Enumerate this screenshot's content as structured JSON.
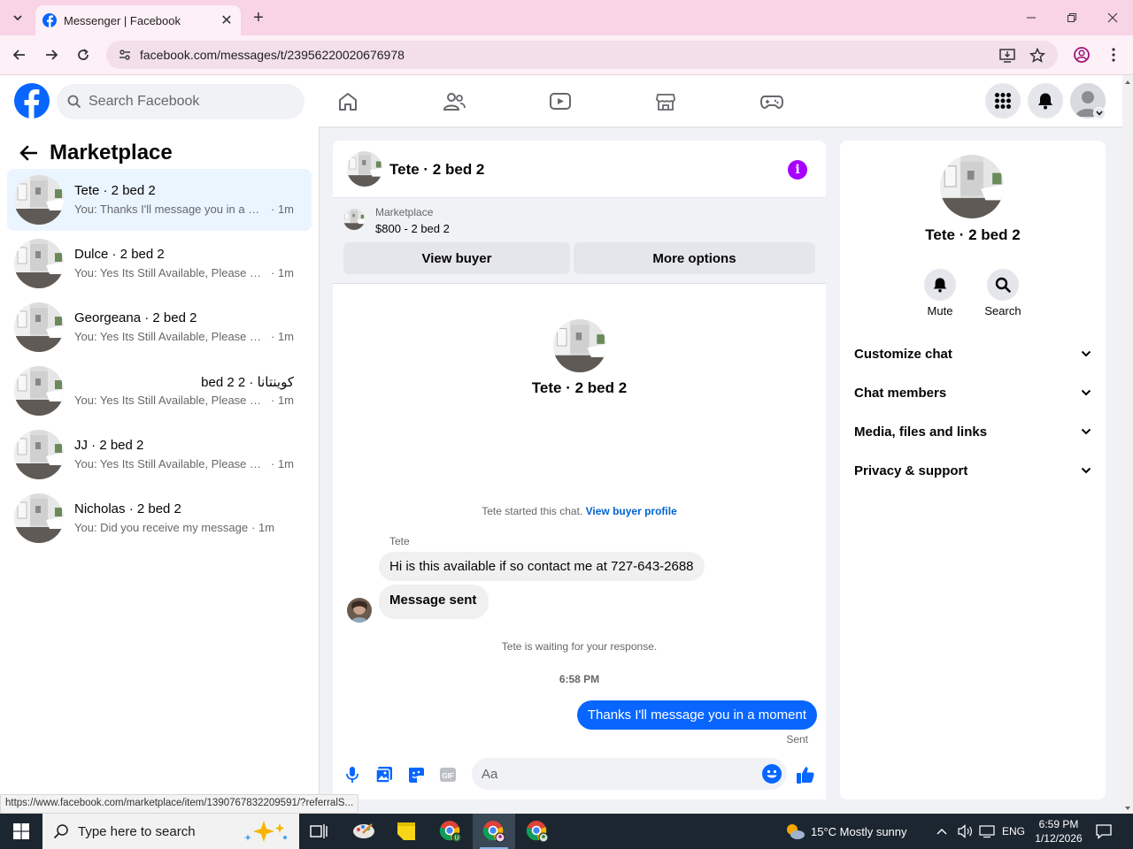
{
  "browser": {
    "tab_title": "Messenger | Facebook",
    "url": "facebook.com/messages/t/23956220020676978",
    "status_url": "https://www.facebook.com/marketplace/item/1390767832209591/?referralS..."
  },
  "fb_header": {
    "search_placeholder": "Search Facebook"
  },
  "sidebar": {
    "title": "Marketplace",
    "conversations": [
      {
        "name": "Tete · 2 bed 2",
        "snippet": "You: Thanks I'll message you in a moment",
        "time": "· 1m",
        "active": true
      },
      {
        "name": "Dulce · 2 bed 2",
        "snippet": "You: Yes Its Still Available, Please Send Your Number",
        "time": "· 1m"
      },
      {
        "name": "Georgeana · 2 bed 2",
        "snippet": "You: Yes Its Still Available, Please Send Your Number",
        "time": "· 1m"
      },
      {
        "name": "كوينتانا · 2 bed 2",
        "snippet": "You: Yes Its Still Available, Please Send Your Number",
        "time": "· 1m"
      },
      {
        "name": "JJ · 2 bed 2",
        "snippet": "You: Yes Its Still Available, Please Send Your Number",
        "time": "· 1m"
      },
      {
        "name": "Nicholas · 2 bed 2",
        "snippet": "You: Did you receive my message",
        "time": "· 1m"
      }
    ]
  },
  "chat": {
    "title": "Tete · 2 bed 2",
    "marketplace_label": "Marketplace",
    "listing": "$800 - 2 bed 2",
    "view_buyer_label": "View buyer",
    "more_options_label": "More options",
    "intro_name": "Tete · 2 bed 2",
    "started_text": "Tete started this chat.",
    "view_buyer_profile": "View buyer profile",
    "sender_name": "Tete",
    "incoming_messages": [
      "Hi is this available if so contact me at 727-643-2688",
      "Message sent"
    ],
    "waiting_text": "Tete is waiting for your response.",
    "timestamp": "6:58 PM",
    "outgoing_message": "Thanks I'll message you in a moment",
    "sent_label": "Sent",
    "composer_placeholder": "Aa"
  },
  "info_panel": {
    "name": "Tete · 2 bed 2",
    "mute_label": "Mute",
    "search_label": "Search",
    "rows": [
      "Customize chat",
      "Chat members",
      "Media, files and links",
      "Privacy & support"
    ]
  },
  "taskbar": {
    "search_placeholder": "Type here to search",
    "weather": "15°C  Mostly sunny",
    "language": "ENG",
    "time": "6:59 PM",
    "date": "1/12/2026"
  },
  "colors": {
    "facebook_blue": "#0866ff",
    "messenger_purple": "#a800ff",
    "browser_pink": "#f9d3e6",
    "active_conversation": "#ebf5ff"
  }
}
